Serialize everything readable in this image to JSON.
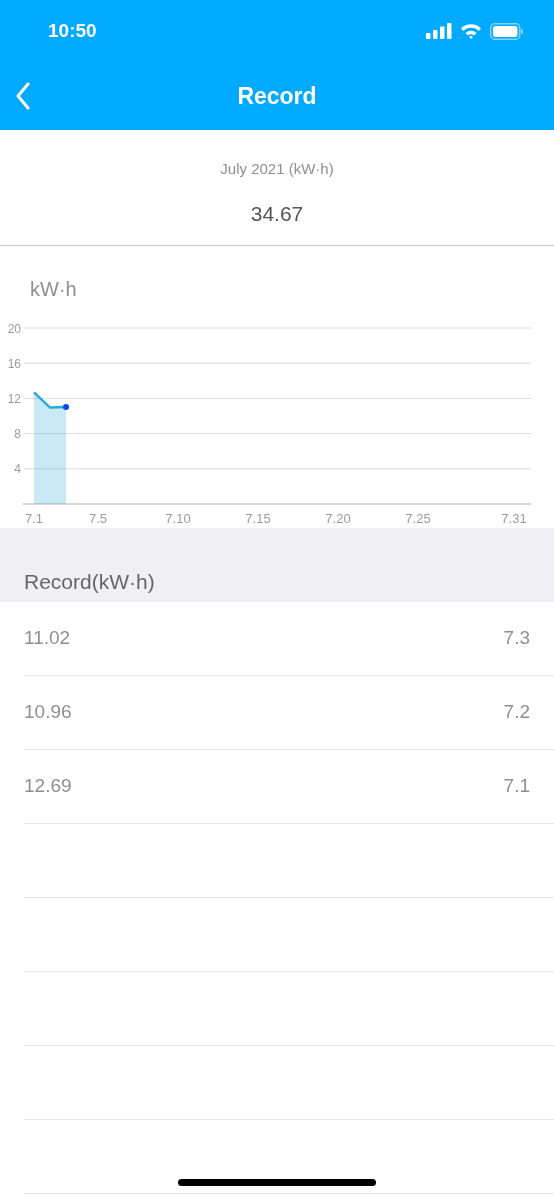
{
  "status_bar": {
    "time": "10:50"
  },
  "nav": {
    "title": "Record"
  },
  "summary": {
    "period": "July 2021 (kW·h)",
    "total": "34.67"
  },
  "chart": {
    "chart_data": {
      "type": "area",
      "ylabel": "kW·h",
      "categories": [
        "7.1",
        null,
        null,
        null,
        "7.5",
        null,
        null,
        null,
        null,
        "7.10",
        null,
        null,
        null,
        null,
        "7.15",
        null,
        null,
        null,
        null,
        "7.20",
        null,
        null,
        null,
        null,
        "7.25",
        null,
        null,
        null,
        null,
        null,
        "7.31"
      ],
      "series": [
        {
          "color": "#29a9d6",
          "values": [
            12.69,
            10.96,
            11.02,
            null,
            null,
            null,
            null,
            null,
            null,
            null,
            null,
            null,
            null,
            null,
            null,
            null,
            null,
            null,
            null,
            null,
            null,
            null,
            null,
            null,
            null,
            null,
            null,
            null,
            null,
            null,
            null
          ]
        }
      ],
      "ylim": [
        0,
        20
      ],
      "grid": true,
      "yticks": [
        4,
        8,
        12,
        16,
        20
      ]
    }
  },
  "records": {
    "title": "Record(kW·h)",
    "rows": [
      {
        "value": "11.02",
        "date": "7.3"
      },
      {
        "value": "10.96",
        "date": "7.2"
      },
      {
        "value": "12.69",
        "date": "7.1"
      }
    ]
  }
}
